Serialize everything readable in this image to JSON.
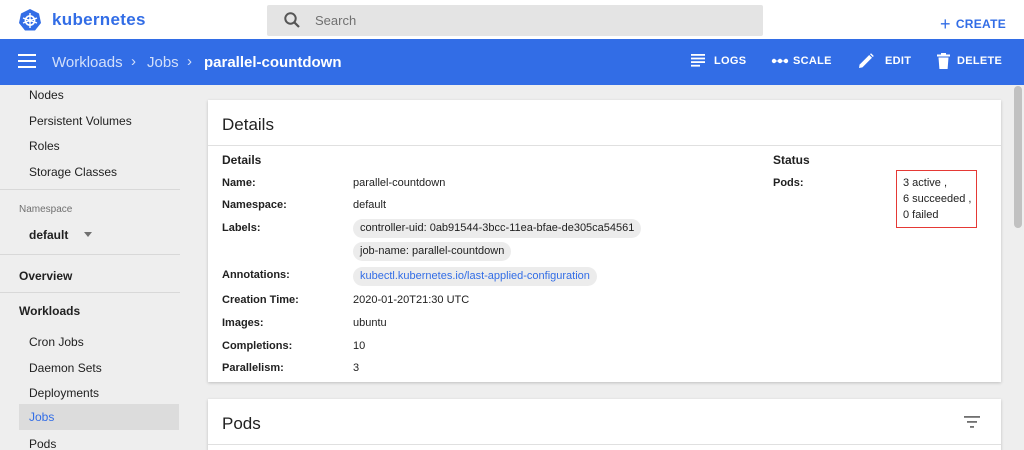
{
  "app": {
    "brand": "kubernetes"
  },
  "search": {
    "placeholder": "Search"
  },
  "header": {
    "create_label": "CREATE"
  },
  "breadcrumb": {
    "items": [
      "Workloads",
      "Jobs",
      "parallel-countdown"
    ]
  },
  "actions": {
    "logs": "LOGS",
    "scale": "SCALE",
    "edit": "EDIT",
    "delete": "DELETE"
  },
  "sidebar": {
    "cluster_items": [
      "Nodes",
      "Persistent Volumes",
      "Roles",
      "Storage Classes"
    ],
    "namespace_label": "Namespace",
    "namespace_value": "default",
    "overview": "Overview",
    "workloads_heading": "Workloads",
    "workload_items": [
      "Cron Jobs",
      "Daemon Sets",
      "Deployments",
      "Jobs",
      "Pods"
    ],
    "active_item": "Jobs"
  },
  "details_card": {
    "title": "Details",
    "details_heading": "Details",
    "status_heading": "Status",
    "fields": {
      "name": {
        "key": "Name:",
        "value": "parallel-countdown"
      },
      "namespace": {
        "key": "Namespace:",
        "value": "default"
      },
      "labels": {
        "key": "Labels:",
        "values": [
          "controller-uid: 0ab91544-3bcc-11ea-bfae-de305ca54561",
          "job-name: parallel-countdown"
        ]
      },
      "annotations": {
        "key": "Annotations:",
        "value": "kubectl.kubernetes.io/last-applied-configuration"
      },
      "creation_time": {
        "key": "Creation Time:",
        "value": "2020-01-20T21:30 UTC"
      },
      "images": {
        "key": "Images:",
        "value": "ubuntu"
      },
      "completions": {
        "key": "Completions:",
        "value": "10"
      },
      "parallelism": {
        "key": "Parallelism:",
        "value": "3"
      }
    },
    "pods_status": {
      "key": "Pods:",
      "lines": [
        "3 active ,",
        "6 succeeded ,",
        "0 failed"
      ]
    }
  },
  "pods_card": {
    "title": "Pods"
  },
  "colors": {
    "accent": "#326de6",
    "highlight_box": "#e53935"
  }
}
